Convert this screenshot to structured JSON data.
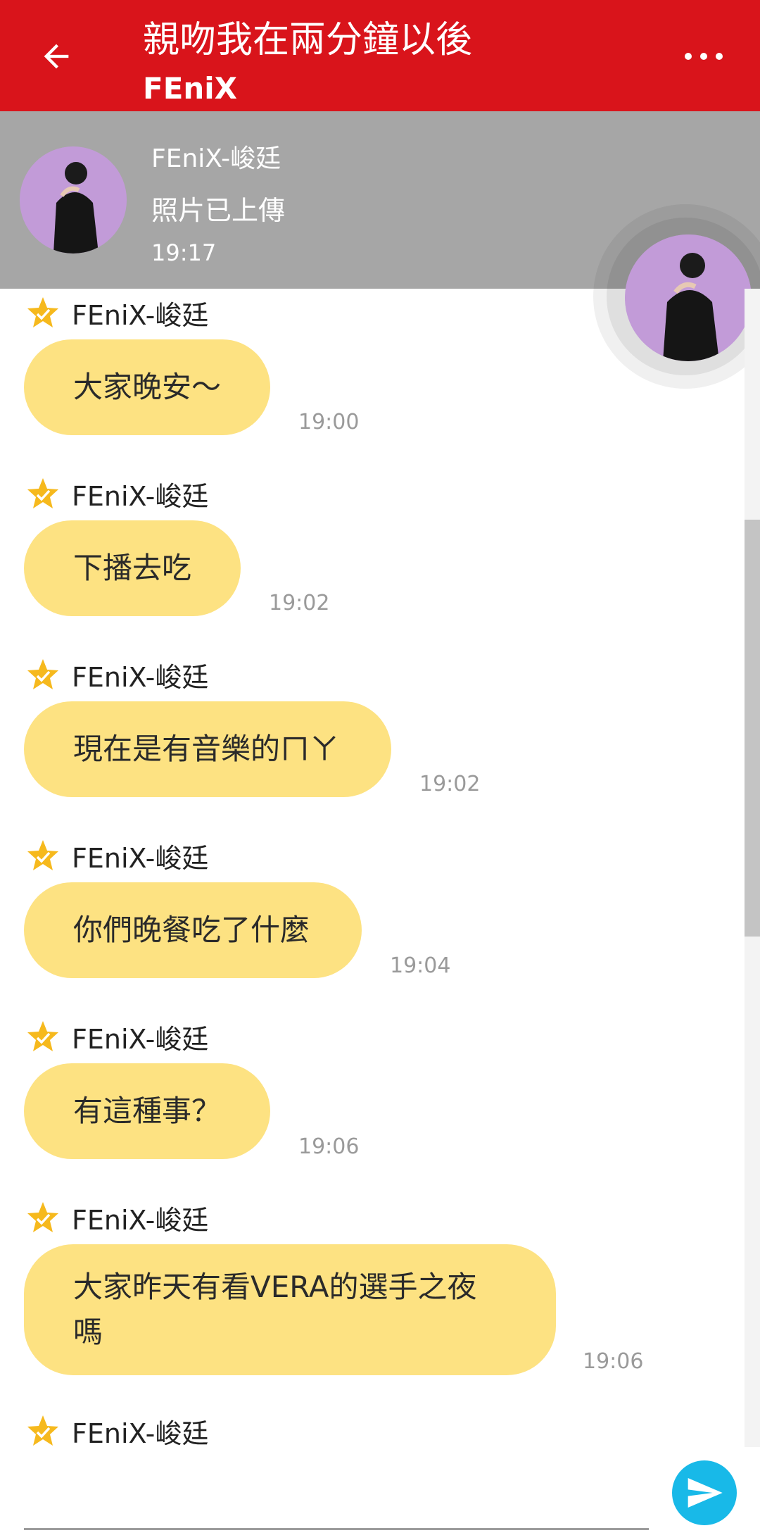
{
  "header": {
    "title": "親吻我在兩分鐘以後",
    "subtitle": "FEniX"
  },
  "pinned": {
    "name": "FEniX-峻廷",
    "text": "照片已上傳",
    "time": "19:17"
  },
  "messages": [
    {
      "sender": "FEniX-峻廷",
      "text": "大家晚安～",
      "time": "19:00"
    },
    {
      "sender": "FEniX-峻廷",
      "text": "下播去吃",
      "time": "19:02"
    },
    {
      "sender": "FEniX-峻廷",
      "text": "現在是有音樂的ㄇㄚ",
      "time": "19:02"
    },
    {
      "sender": "FEniX-峻廷",
      "text": "你們晚餐吃了什麼",
      "time": "19:04"
    },
    {
      "sender": "FEniX-峻廷",
      "text": "有這種事？",
      "time": "19:06"
    },
    {
      "sender": "FEniX-峻廷",
      "text_line1": "大家昨天有看VERA的選手之夜",
      "text_line2": "嗎",
      "time": "19:06"
    },
    {
      "sender": "FEniX-峻廷"
    }
  ],
  "icons": {
    "back": "arrow-left-icon",
    "more": "more-dots-icon",
    "star": "star-check-icon",
    "send": "send-icon"
  },
  "colors": {
    "header_bg": "#d9141b",
    "pinned_bg": "#a6a6a6",
    "bubble": "#fde282",
    "send": "#18b9e8"
  }
}
